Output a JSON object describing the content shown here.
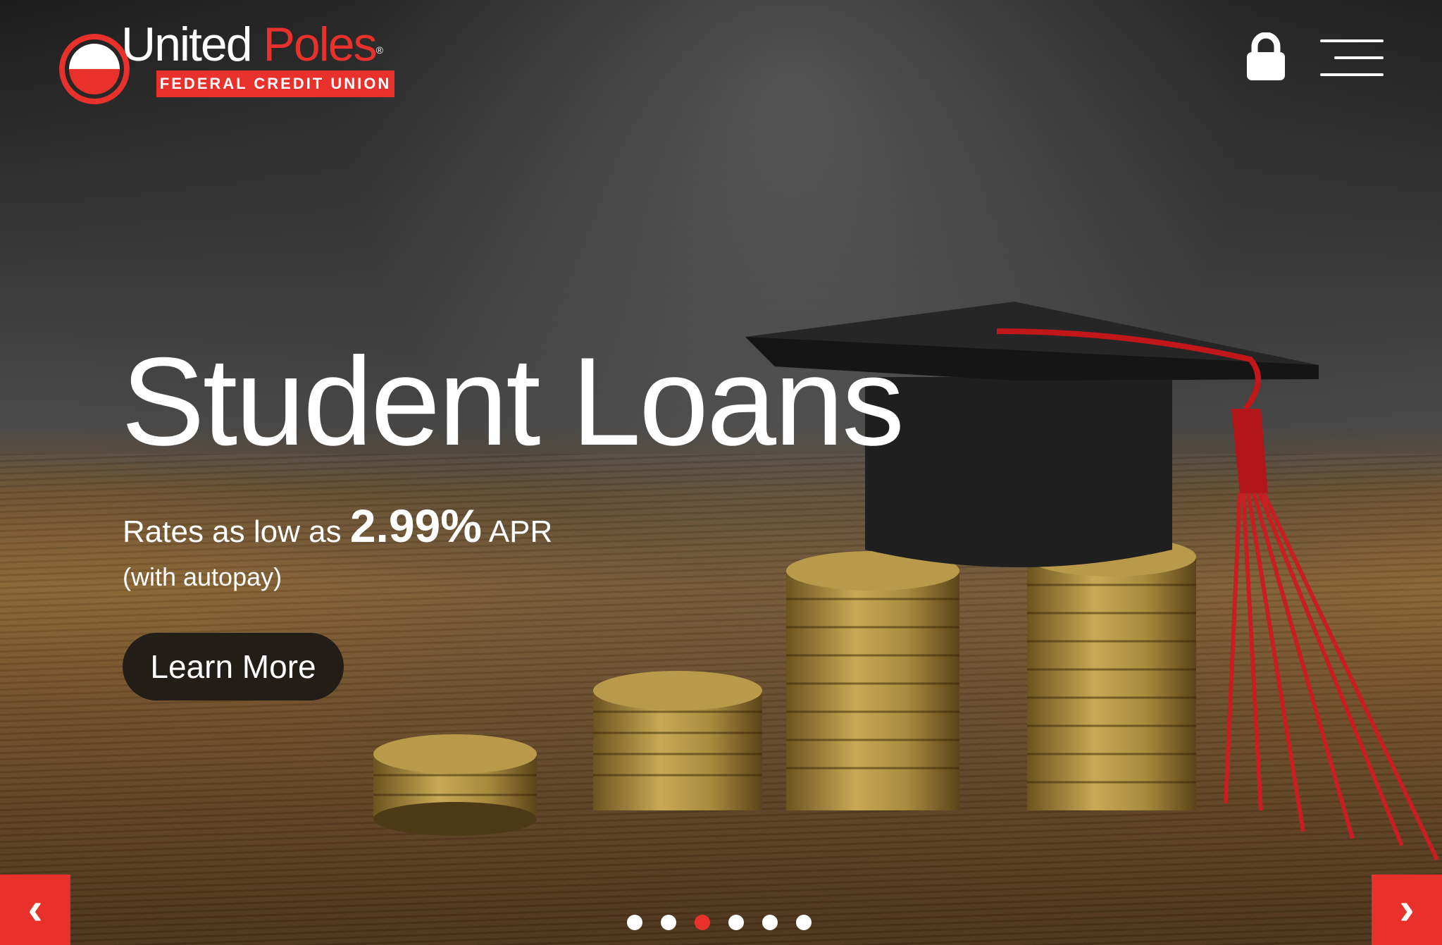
{
  "brand": {
    "name_white": "United",
    "name_red": "Poles",
    "registered": "®",
    "tagline": "FEDERAL CREDIT UNION",
    "primary_color": "#e8312b"
  },
  "header": {
    "login_icon": "lock-icon",
    "menu_icon": "hamburger-menu-icon"
  },
  "slide": {
    "headline": "Student Loans",
    "rates_prefix": "Rates as low as",
    "rate_value": "2.99%",
    "rate_suffix": "APR",
    "note": "(with autopay)",
    "cta_label": "Learn More"
  },
  "carousel": {
    "prev_label": "‹",
    "next_label": "›",
    "slide_count": 6,
    "active_slide": 3
  }
}
